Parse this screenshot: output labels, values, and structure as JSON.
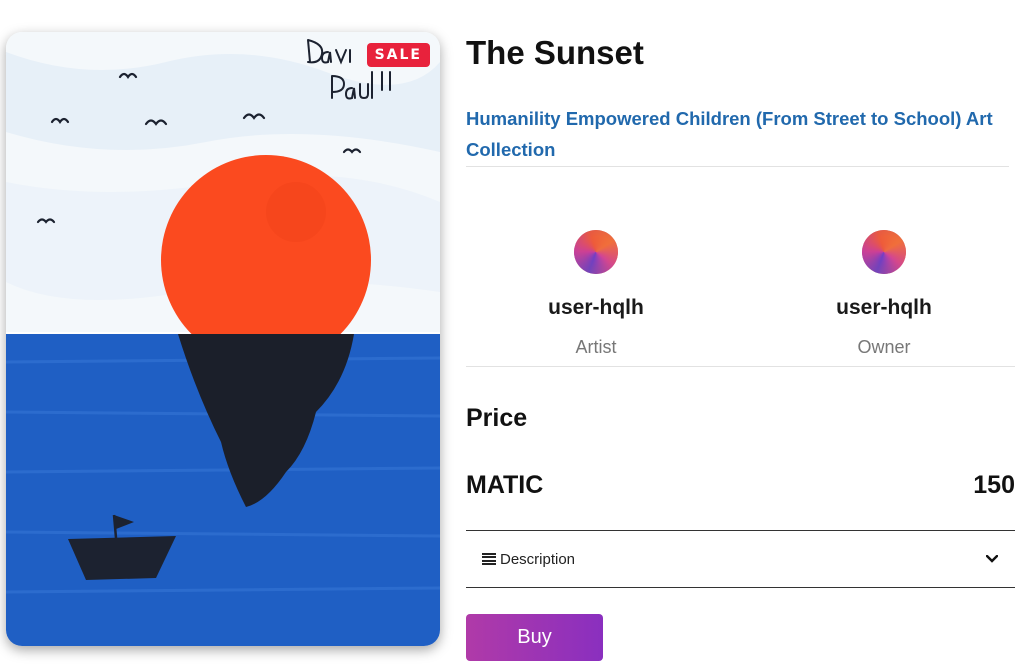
{
  "artwork": {
    "badge": "SALE",
    "signature": "David Paul!!",
    "colors": {
      "sky": "#f4f8fb",
      "sun": "#fb4a1f",
      "sea": "#1f5fc4",
      "reflection": "#1b1f2a",
      "boat": "#1c2230"
    }
  },
  "item": {
    "title": "The Sunset",
    "collection": "Humanility Empowered Children (From Street to School) Art Collection"
  },
  "people": [
    {
      "username": "user-hqlh",
      "role": "Artist",
      "icon": "avatar"
    },
    {
      "username": "user-hqlh",
      "role": "Owner",
      "icon": "avatar"
    }
  ],
  "price": {
    "heading": "Price",
    "currency": "MATIC",
    "amount": "150"
  },
  "description": {
    "label": "Description",
    "icon": "list-icon",
    "toggle_icon": "chevron-down-icon"
  },
  "actions": {
    "buy_label": "Buy",
    "buy_color_start": "#b03aa8",
    "buy_color_end": "#8a2fbf"
  }
}
